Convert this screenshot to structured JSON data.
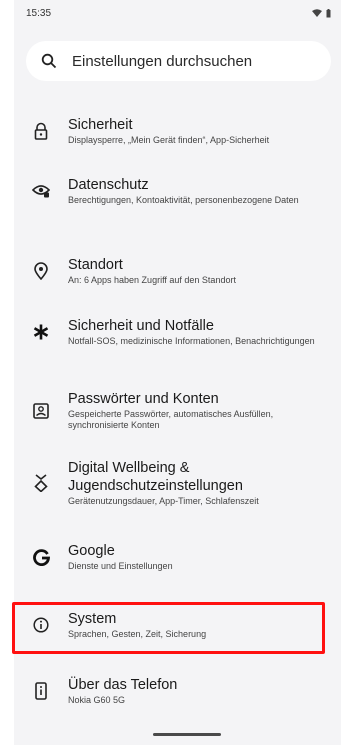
{
  "status_bar": {
    "time": "15:35"
  },
  "search": {
    "placeholder": "Einstellungen durchsuchen"
  },
  "items": [
    {
      "title": "Sicherheit",
      "subtitle": "Displaysperre, „Mein Gerät finden“, App-Sicherheit",
      "icon": "lock-icon"
    },
    {
      "title": "Datenschutz",
      "subtitle": "Berechtigungen, Kontoaktivität, personenbezogene Daten",
      "icon": "privacy-eye-icon"
    },
    {
      "title": "Standort",
      "subtitle": "An: 6 Apps haben Zugriff auf den Standort",
      "icon": "location-pin-icon"
    },
    {
      "title": "Sicherheit und Notfälle",
      "subtitle": "Notfall-SOS, medizinische Informationen, Benachrichtigungen",
      "icon": "emergency-asterisk-icon"
    },
    {
      "title": "Passwörter und Konten",
      "subtitle": "Gespeicherte Passwörter, automatisches Ausfüllen, synchronisierte Konten",
      "icon": "account-box-icon"
    },
    {
      "title": "Digital Wellbeing & Jugendschutzeinstellungen",
      "subtitle": "Gerätenutzungsdauer, App-Timer, Schlafenszeit",
      "icon": "wellbeing-icon"
    },
    {
      "title": "Google",
      "subtitle": "Dienste und Einstellungen",
      "icon": "google-icon"
    },
    {
      "title": "System",
      "subtitle": "Sprachen, Gesten, Zeit, Sicherung",
      "icon": "info-icon"
    },
    {
      "title": "Über das Telefon",
      "subtitle": "Nokia G60 5G",
      "icon": "phone-info-icon"
    }
  ],
  "colors": {
    "highlight": "#ff1010",
    "background": "#f4f4f6"
  }
}
